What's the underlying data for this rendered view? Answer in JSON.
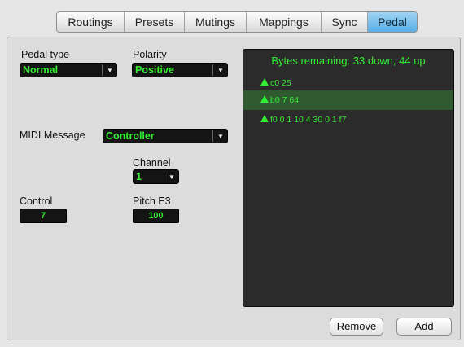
{
  "tabs": [
    "Routings",
    "Presets",
    "Mutings",
    "Mappings",
    "Sync",
    "Pedal"
  ],
  "active_tab": "Pedal",
  "pedal_type": {
    "label": "Pedal type",
    "value": "Normal"
  },
  "polarity": {
    "label": "Polarity",
    "value": "Positive"
  },
  "midi_message": {
    "label": "MIDI Message",
    "value": "Controller"
  },
  "channel": {
    "label": "Channel",
    "value": "1"
  },
  "control": {
    "label": "Control",
    "value": "7"
  },
  "pitch": {
    "label": "Pitch E3",
    "value": "100"
  },
  "messages": {
    "header": "Bytes remaining: 33 down, 44 up",
    "items": [
      "c0 25",
      "b0 7 64",
      "f0 0 1 10 4 30 0 1 f7"
    ],
    "selected_index": 1
  },
  "buttons": {
    "remove": "Remove",
    "add": "Add"
  },
  "colors": {
    "accent_green": "#33ee33",
    "active_tab_blue": "#58aee6",
    "list_bg": "#2b2b2b"
  },
  "icons": {
    "expand": "triangle-up-icon",
    "dropdown": "chevron-down-icon"
  }
}
